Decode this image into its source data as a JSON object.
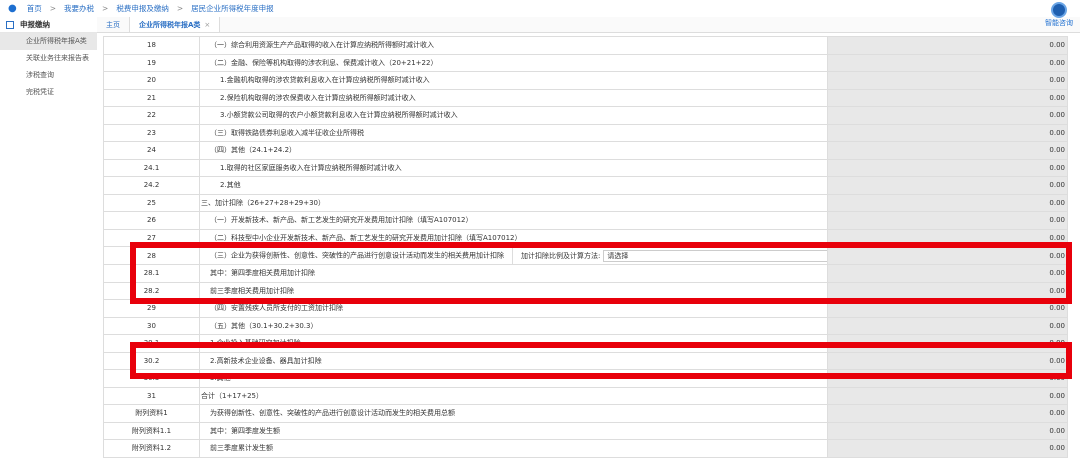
{
  "breadcrumb": [
    "首页",
    "我要办税",
    "税费申报及缴纳",
    "居民企业所得税年度申报"
  ],
  "sidebar": {
    "title": "申报缴纳",
    "items": [
      "企业所得税年报A类",
      "关联业务往来报告表",
      "涉税查询",
      "完税凭证"
    ]
  },
  "tabs": [
    {
      "label": "主页"
    },
    {
      "label": "企业所得税年报A类",
      "close": "×"
    }
  ],
  "assistant": {
    "label": "智能咨询"
  },
  "select": {
    "label": "加计扣除比例及计算方法:",
    "value": "请选择",
    "arrow": "▾"
  },
  "rows": [
    {
      "no": "18",
      "desc": "（一）综合利用资源生产产品取得的收入在计算应纳税所得额时减计收入",
      "value": "0.00",
      "indent": 1
    },
    {
      "no": "19",
      "desc": "（二）金融、保险等机构取得的涉农利息、保费减计收入（20+21+22）",
      "value": "0.00",
      "indent": 1
    },
    {
      "no": "20",
      "desc": "1.金融机构取得的涉农贷款利息收入在计算应纳税所得额时减计收入",
      "value": "0.00",
      "indent": 2
    },
    {
      "no": "21",
      "desc": "2.保险机构取得的涉农保费收入在计算应纳税所得额时减计收入",
      "value": "0.00",
      "indent": 2
    },
    {
      "no": "22",
      "desc": "3.小额贷款公司取得的农户小额贷款利息收入在计算应纳税所得额时减计收入",
      "value": "0.00",
      "indent": 2
    },
    {
      "no": "23",
      "desc": "（三）取得铁路债券利息收入减半征收企业所得税",
      "value": "0.00",
      "indent": 1
    },
    {
      "no": "24",
      "desc": "（四）其他（24.1+24.2）",
      "value": "0.00",
      "indent": 1
    },
    {
      "no": "24.1",
      "desc": "1.取得的社区家庭服务收入在计算应纳税所得额时减计收入",
      "value": "0.00",
      "indent": 2
    },
    {
      "no": "24.2",
      "desc": "2.其他",
      "value": "0.00",
      "indent": 2
    },
    {
      "no": "25",
      "desc": "三、加计扣除（26+27+28+29+30）",
      "value": "0.00",
      "indent": 0
    },
    {
      "no": "26",
      "desc": "（一）开发新技术、新产品、新工艺发生的研究开发费用加计扣除（填写A107012）",
      "value": "0.00",
      "indent": 1
    },
    {
      "no": "27",
      "desc": "（二）科技型中小企业开发新技术、新产品、新工艺发生的研究开发费用加计扣除（填写A107012）",
      "value": "0.00",
      "indent": 1
    },
    {
      "no": "28",
      "desc": "（三）企业为获得创新性、创意性、突破性的产品进行创意设计活动而发生的相关费用加计扣除",
      "value": "0.00",
      "indent": 1,
      "select": true
    },
    {
      "no": "28.1",
      "desc": "其中：第四季度相关费用加计扣除",
      "value": "0.00",
      "indent": 1
    },
    {
      "no": "28.2",
      "desc": "前三季度相关费用加计扣除",
      "value": "0.00",
      "indent": 1
    },
    {
      "no": "29",
      "desc": "（四）安置残疾人员所支付的工资加计扣除",
      "value": "0.00",
      "indent": 1
    },
    {
      "no": "30",
      "desc": "（五）其他（30.1+30.2+30.3）",
      "value": "0.00",
      "indent": 1
    },
    {
      "no": "30.1",
      "desc": "1.企业投入基础研究加计扣除",
      "value": "0.00",
      "indent": 1
    },
    {
      "no": "30.2",
      "desc": "2.高新技术企业设备、器具加计扣除",
      "value": "0.00",
      "indent": 1
    },
    {
      "no": "30.3",
      "desc": "3.其他",
      "value": "0.00",
      "indent": 1
    },
    {
      "no": "31",
      "desc": "合计（1+17+25）",
      "value": "0.00",
      "indent": 0
    },
    {
      "no": "附列资料1",
      "desc": "为获得创新性、创意性、突破性的产品进行创意设计活动而发生的相关费用总额",
      "value": "0.00",
      "indent": 1
    },
    {
      "no": "附列资料1.1",
      "desc": "其中：第四季度发生额",
      "value": "0.00",
      "indent": 1
    },
    {
      "no": "附列资料1.2",
      "desc": "前三季度累计发生额",
      "value": "0.00",
      "indent": 1
    }
  ],
  "colors": {
    "highlight": "#e8000b",
    "accent": "#2a6fc4"
  }
}
